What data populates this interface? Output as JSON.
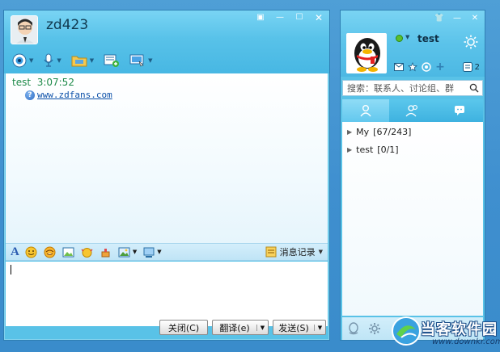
{
  "chat": {
    "contact_name": "zd423",
    "message": {
      "sender": "test",
      "time": "3:07:52",
      "link": "www.zdfans.com"
    },
    "history_label": "消息记录",
    "buttons": {
      "close": "关闭(C)",
      "translate": "翻译(e)",
      "send": "发送(S)"
    }
  },
  "main_panel": {
    "nickname": "test",
    "app_count": "2",
    "search_placeholder": "搜索：联系人、讨论组、群",
    "groups": [
      {
        "name": "My",
        "count": "[67/243]"
      },
      {
        "name": "test",
        "count": "[0/1]"
      }
    ]
  },
  "watermark": {
    "text": "当客软件园",
    "url": "www.downkr.com"
  },
  "colors": {
    "titlebar": "#59c2e7",
    "desktop": "#4a98d3",
    "message_header": "#1e8a4a",
    "link": "#0b4fa8"
  }
}
